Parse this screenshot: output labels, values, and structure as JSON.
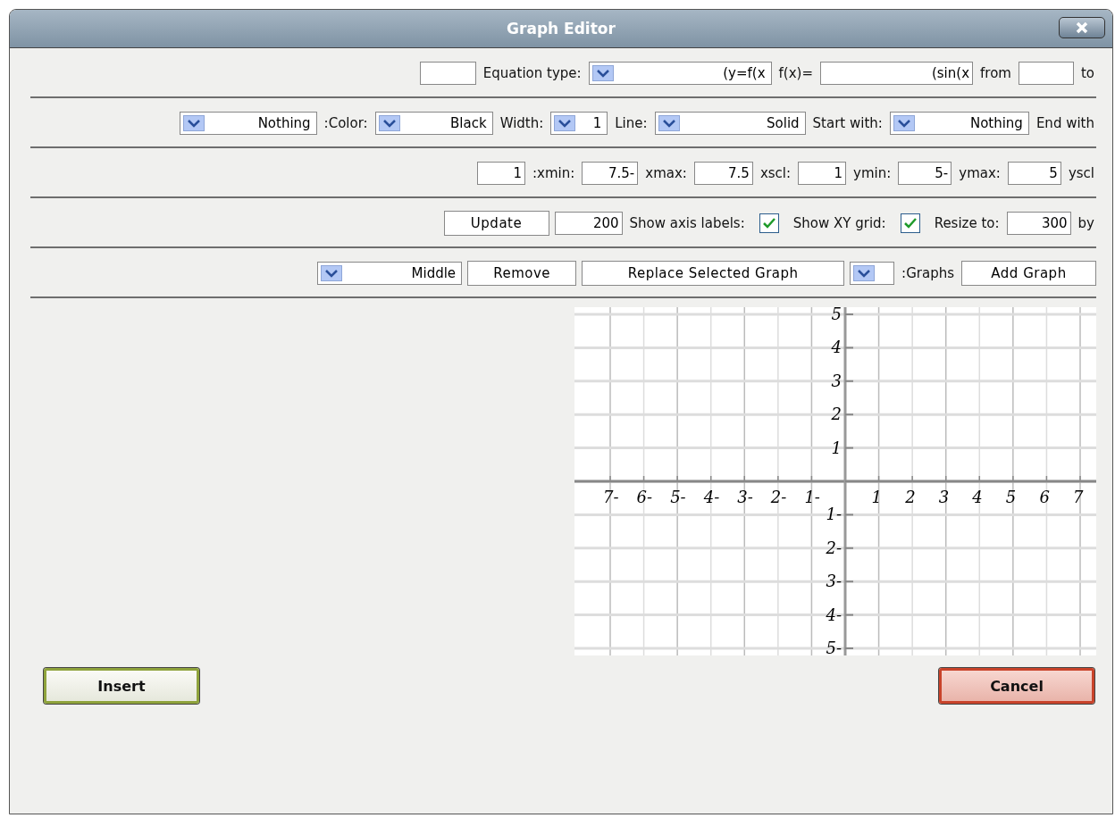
{
  "window": {
    "title": "Graph Editor"
  },
  "rows": [
    [
      {
        "kind": "field"
      },
      {
        "kind": "label",
        "text": "Equation type:"
      },
      {
        "kind": "dropdown",
        "value": "(y=f(x"
      },
      {
        "kind": "label",
        "text": "f(x)="
      },
      {
        "kind": "field",
        "value": "(sin(x"
      },
      {
        "kind": "label",
        "text": "from"
      },
      {
        "kind": "field"
      },
      {
        "kind": "label",
        "text": "to"
      }
    ],
    [
      {
        "kind": "dropdown",
        "value": "Nothing"
      },
      {
        "kind": "label",
        "text": ":Color:"
      },
      {
        "kind": "dropdown",
        "value": "Black"
      },
      {
        "kind": "label",
        "text": "Width:"
      },
      {
        "kind": "dropdown",
        "value": "1"
      },
      {
        "kind": "label",
        "text": "Line:"
      },
      {
        "kind": "dropdown",
        "value": "Solid"
      },
      {
        "kind": "label",
        "text": "Start with:"
      },
      {
        "kind": "dropdown",
        "value": "Nothing"
      },
      {
        "kind": "label",
        "text": "End with"
      }
    ],
    [
      {
        "kind": "field",
        "value": "1"
      },
      {
        "kind": "label",
        "text": ":xmin:"
      },
      {
        "kind": "field",
        "value": "7.5-"
      },
      {
        "kind": "label",
        "text": "xmax:"
      },
      {
        "kind": "field",
        "value": "7.5"
      },
      {
        "kind": "label",
        "text": "xscl:"
      },
      {
        "kind": "field",
        "value": "1"
      },
      {
        "kind": "label",
        "text": "ymin:"
      },
      {
        "kind": "field",
        "value": "5-"
      },
      {
        "kind": "label",
        "text": "ymax:"
      },
      {
        "kind": "field",
        "value": "5"
      },
      {
        "kind": "label",
        "text": "yscl"
      }
    ],
    [
      {
        "kind": "button",
        "text": "Update"
      },
      {
        "kind": "field",
        "value": "200"
      },
      {
        "kind": "label",
        "text": "Show axis labels:"
      },
      {
        "kind": "checkbox",
        "checked": true
      },
      {
        "kind": "label",
        "text": "Show XY grid:"
      },
      {
        "kind": "checkbox",
        "checked": true
      },
      {
        "kind": "label",
        "text": "Resize to:"
      },
      {
        "kind": "field",
        "value": "300"
      },
      {
        "kind": "label",
        "text": "by"
      }
    ],
    [
      {
        "kind": "dropdown",
        "value": "Middle"
      },
      {
        "kind": "button",
        "text": "Remove"
      },
      {
        "kind": "button",
        "text": "Replace Selected Graph"
      },
      {
        "kind": "dropdown"
      },
      {
        "kind": "label",
        "text": ":Graphs"
      },
      {
        "kind": "button",
        "text": "Add Graph"
      }
    ]
  ],
  "graph": {
    "x_left_labels": [
      "7-",
      "6-",
      "5-",
      "4-",
      "3-",
      "2-",
      "1-"
    ],
    "x_right_labels": [
      "1",
      "2",
      "3",
      "4",
      "5",
      "6",
      "7"
    ],
    "y_top_labels": [
      "5",
      "4",
      "3",
      "2",
      "1"
    ],
    "y_bottom_labels": [
      "1-",
      "2-",
      "3-",
      "4-",
      "5-"
    ]
  },
  "buttons": [
    {
      "kind": "ok",
      "text": "Insert"
    },
    {
      "kind": "cancel",
      "text": "Cancel"
    }
  ]
}
